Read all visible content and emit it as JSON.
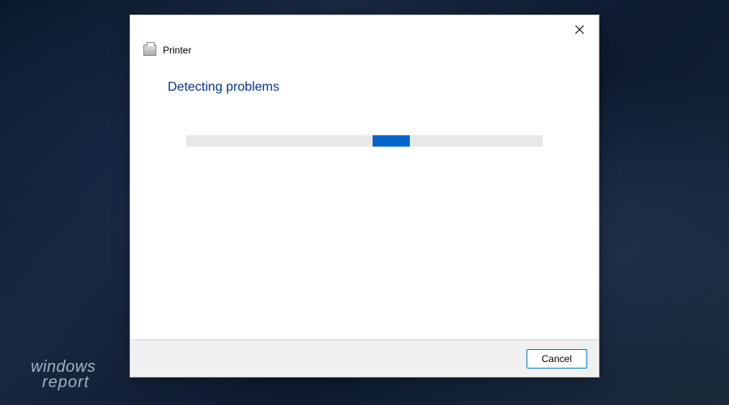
{
  "dialog": {
    "title": "Printer",
    "heading": "Detecting problems",
    "progress": {
      "indeterminate": true,
      "chunk_position_percent": 50
    },
    "cancel_label": "Cancel"
  },
  "icons": {
    "close": "close-icon",
    "printer": "printer-icon"
  },
  "watermark": {
    "line1": "windows",
    "line2": "report"
  }
}
